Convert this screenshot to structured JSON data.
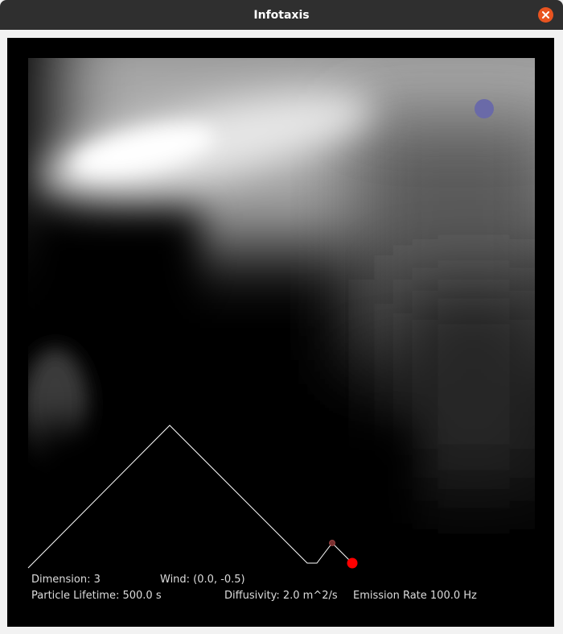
{
  "window": {
    "title": "Infotaxis",
    "close_icon": "close-icon",
    "accent": "#e95420"
  },
  "colors": {
    "background": "#000000",
    "trajectory": "#ffffff",
    "source_marker": "#6a6aa8",
    "agent_marker": "#ff0000",
    "waypoint_marker": "#7a3030",
    "info_text": "#dcdcdc"
  },
  "info": {
    "dimension": "Dimension: 3",
    "wind": "Wind: (0.0, -0.5)",
    "lifetime": "Particle Lifetime: 500.0 s",
    "diffusivity": "Diffusivity: 2.0 m^2/s",
    "emission": "Emission Rate 100.0 Hz"
  }
}
